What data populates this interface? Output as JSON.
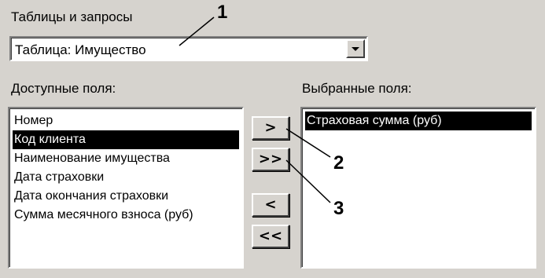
{
  "tables_label": "Таблицы и запросы",
  "table_select": {
    "value": "Таблица: Имущество"
  },
  "available": {
    "label": "Доступные поля:",
    "items": [
      {
        "label": "Номер"
      },
      {
        "label": "Код клиента",
        "selected": true
      },
      {
        "label": "Наименование имущества"
      },
      {
        "label": "Дата  страховки"
      },
      {
        "label": "Дата окончания страховки"
      },
      {
        "label": "Сумма месячного взноса (руб)"
      }
    ]
  },
  "selected": {
    "label": "Выбранные поля:",
    "items": [
      {
        "label": "Страховая сумма (руб)",
        "selected": true
      }
    ]
  },
  "buttons": {
    "add_one": ">",
    "add_all": ">>",
    "remove_one": "<",
    "remove_all": "<<"
  },
  "callouts": [
    "1",
    "2",
    "3"
  ]
}
